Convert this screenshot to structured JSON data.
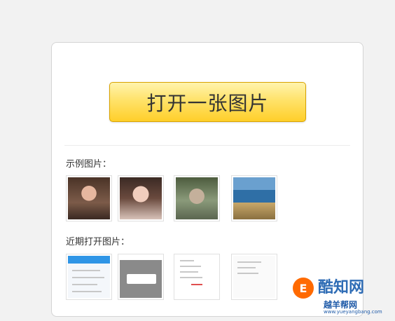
{
  "open_button": {
    "label": "打开一张图片"
  },
  "sample_section": {
    "label": "示例图片：",
    "images": [
      {
        "icon": "portrait-woman-photo"
      },
      {
        "icon": "portrait-woman-photo"
      },
      {
        "icon": "portrait-child-photo"
      },
      {
        "icon": "landscape-sea-photo"
      }
    ]
  },
  "recent_section": {
    "label": "近期打开图片：",
    "images": [
      {
        "icon": "app-screenshot"
      },
      {
        "icon": "dialog-screenshot"
      },
      {
        "icon": "settings-screenshot"
      },
      {
        "icon": "form-screenshot"
      }
    ]
  },
  "watermark": {
    "logo_glyph": "E",
    "brand": "酷知网",
    "sub": "越羊帮网",
    "url": "www.yueyangbang.com"
  }
}
